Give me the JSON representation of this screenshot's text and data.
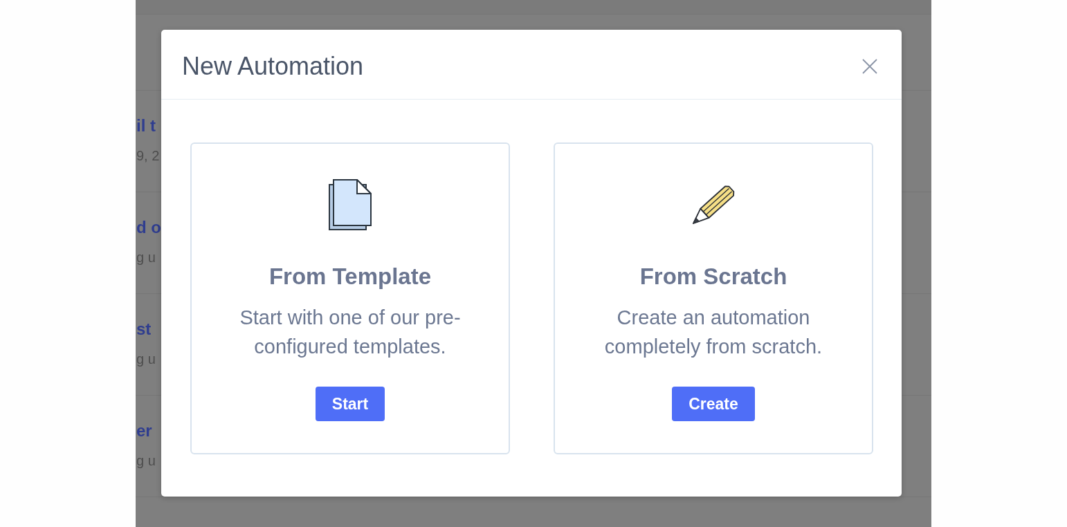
{
  "background_page": {
    "rows": [
      {
        "title": "il t",
        "subtitle": "9, 2"
      },
      {
        "title": "d o",
        "subtitle": "g u"
      },
      {
        "title": "st",
        "subtitle": "g u"
      },
      {
        "title": "er",
        "subtitle": "g u"
      }
    ]
  },
  "dialog": {
    "title": "New Automation",
    "options": [
      {
        "kind": "template",
        "title": "From Template",
        "description": "Start with one of our pre-configured templates.",
        "button": "Start"
      },
      {
        "kind": "scratch",
        "title": "From Scratch",
        "description": "Create an automation completely from scratch.",
        "button": "Create"
      }
    ]
  }
}
